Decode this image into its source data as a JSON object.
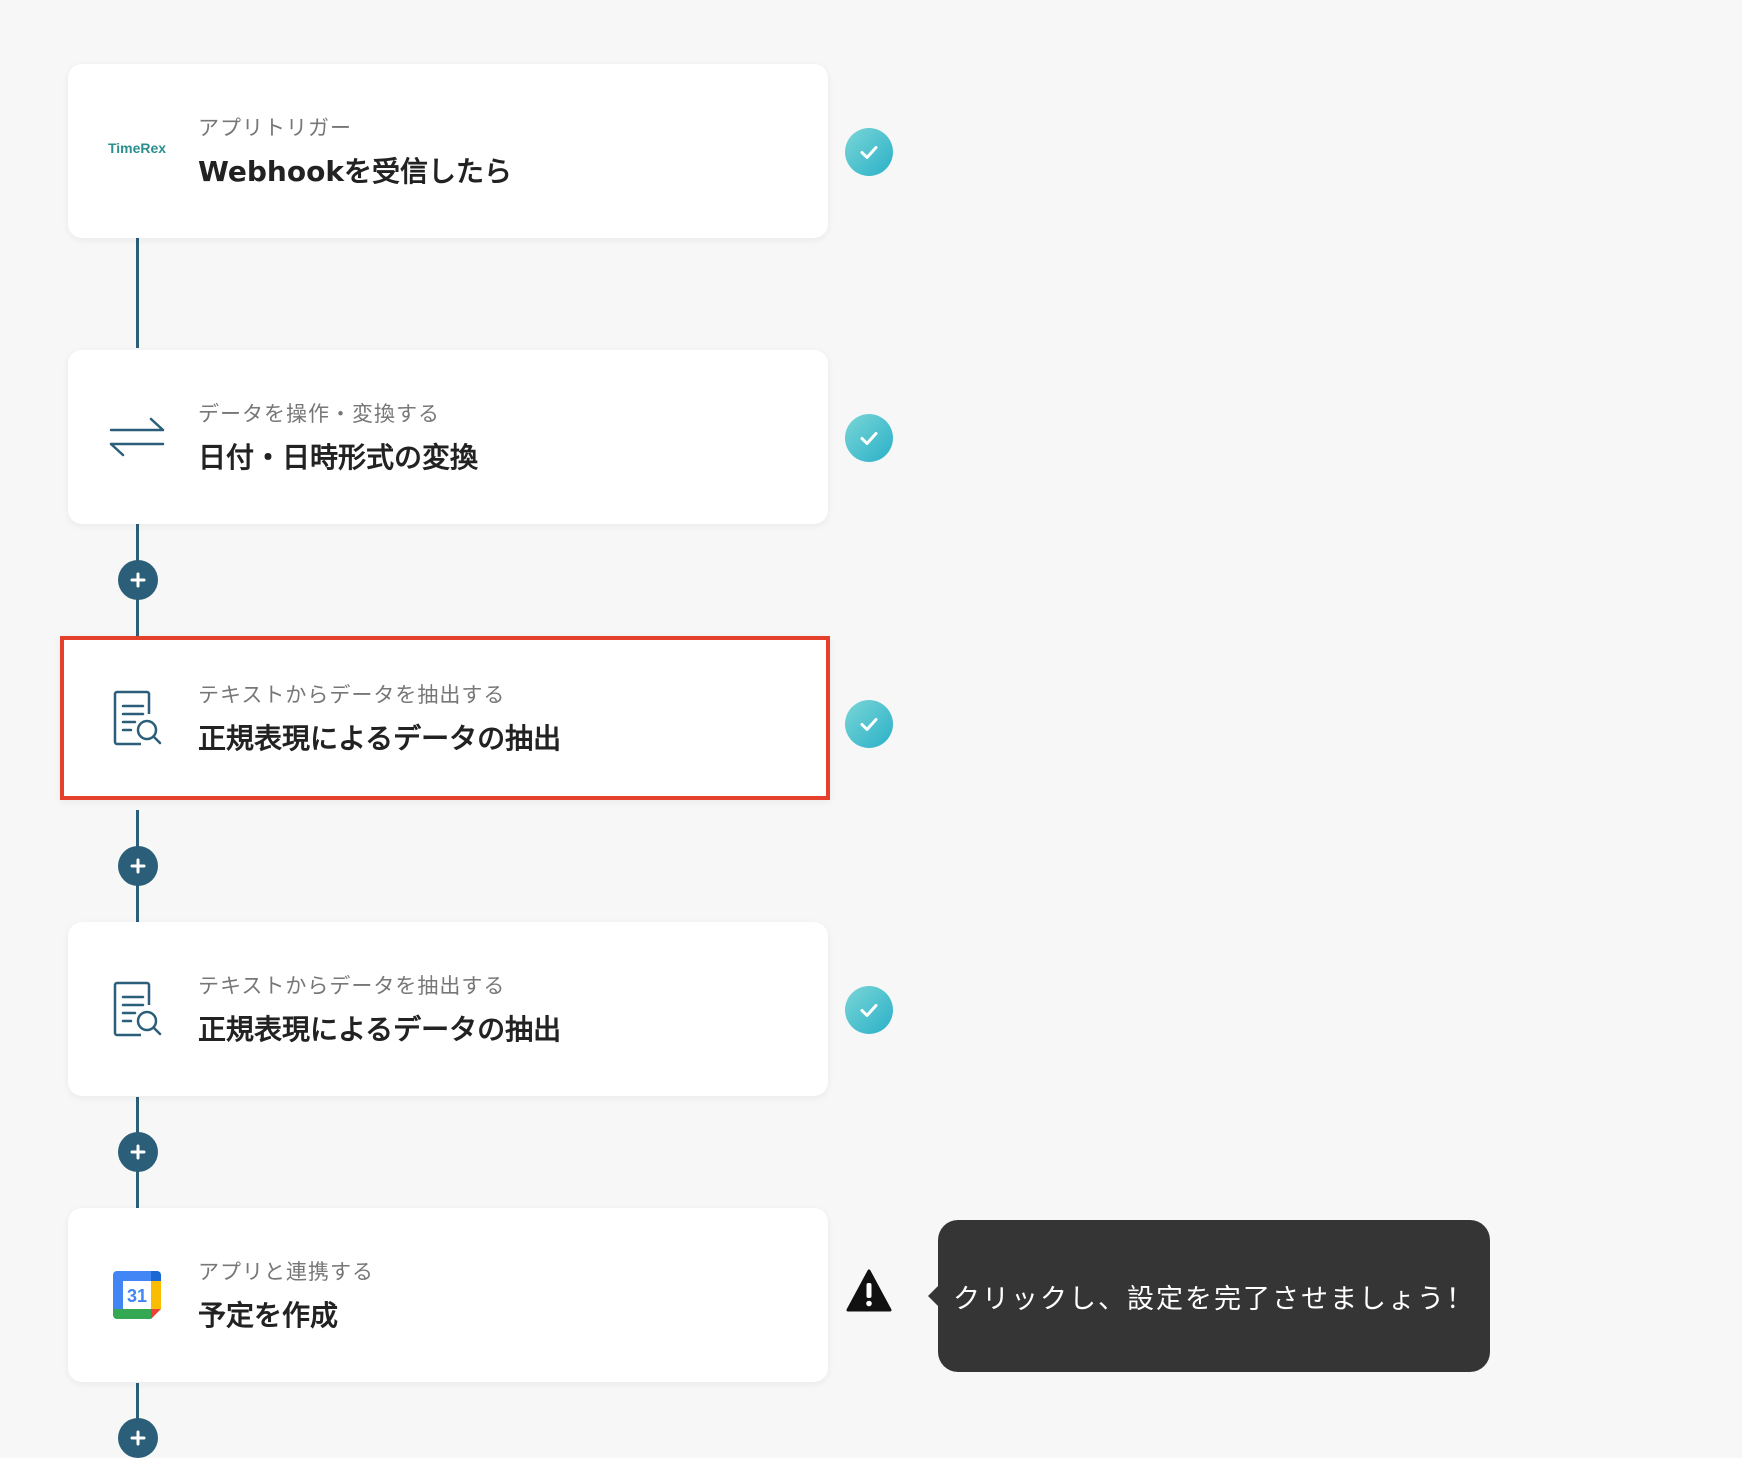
{
  "steps": [
    {
      "subtitle": "アプリトリガー",
      "title": "Webhookを受信したら",
      "icon": "timerex-logo",
      "logo_text": "TimeRex",
      "status": "complete"
    },
    {
      "subtitle": "データを操作・変換する",
      "title": "日付・日時形式の変換",
      "icon": "swap-arrows-icon",
      "status": "complete"
    },
    {
      "subtitle": "テキストからデータを抽出する",
      "title": "正規表現によるデータの抽出",
      "icon": "document-search-icon",
      "status": "complete",
      "highlighted": true
    },
    {
      "subtitle": "テキストからデータを抽出する",
      "title": "正規表現によるデータの抽出",
      "icon": "document-search-icon",
      "status": "complete"
    },
    {
      "subtitle": "アプリと連携する",
      "title": "予定を作成",
      "icon": "google-calendar-icon",
      "calendar_day": "31",
      "status": "warning"
    }
  ],
  "tooltip": {
    "text": "クリックし、設定を完了させましょう！"
  },
  "colors": {
    "connector": "#2b5e78",
    "check": "#2ab0c8",
    "highlight": "#e5402b",
    "tooltip_bg": "#353535"
  }
}
